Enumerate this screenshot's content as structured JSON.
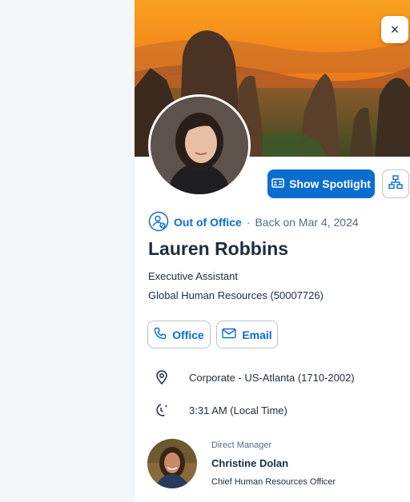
{
  "left_pane": {},
  "profile": {
    "close_label": "×",
    "spotlight_label": "Show Spotlight",
    "status": {
      "label": "Out of Office",
      "separator": "·",
      "back": "Back on Mar 4, 2024"
    },
    "name": "Lauren Robbins",
    "job_title": "Executive Assistant",
    "department": "Global Human Resources (50007726)",
    "actions": {
      "office": "Office",
      "email": "Email"
    },
    "location": "Corporate - US-Atlanta (1710-2002)",
    "local_time": "3:31 AM (Local Time)"
  },
  "manager": {
    "label": "Direct Manager",
    "name": "Christine Dolan",
    "title": "Chief Human Resources Officer"
  },
  "colors": {
    "accent": "#0a6ed1",
    "text": "#1d2d3e",
    "muted": "#556b82"
  },
  "icons": {
    "close": "close-icon",
    "spotlight": "id-card-icon",
    "org_chart": "org-chart-icon",
    "status": "out-of-office-icon",
    "office": "phone-icon",
    "email": "email-icon",
    "location": "location-pin-icon",
    "time": "moon-clock-icon"
  }
}
